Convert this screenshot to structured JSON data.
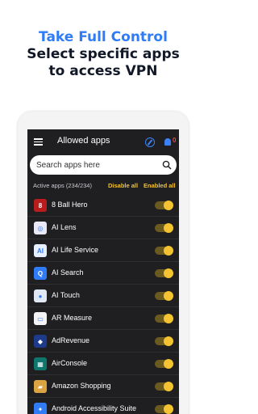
{
  "headline": {
    "line1": "Take Full Control",
    "line2": "Select specific apps",
    "line3": "to access VPN"
  },
  "appbar": {
    "title": "Allowed apps",
    "badge": "0"
  },
  "search": {
    "placeholder": "Search apps here"
  },
  "filters": {
    "active_count": "Active apps (234/234)",
    "disable_all": "Disable all",
    "enable_all": "Enabled all"
  },
  "apps": [
    {
      "name": "8 Ball Hero",
      "icon": "8",
      "color": "#b91c1c",
      "enabled": true
    },
    {
      "name": "AI Lens",
      "icon": "◎",
      "color": "#e8e8f7",
      "enabled": true
    },
    {
      "name": "AI Life Service",
      "icon": "AI",
      "color": "#e5efff",
      "enabled": true
    },
    {
      "name": "AI Search",
      "icon": "Q",
      "color": "#2f7cf6",
      "enabled": true
    },
    {
      "name": "AI Touch",
      "icon": "●",
      "color": "#dfe8f3",
      "enabled": true
    },
    {
      "name": "AR Measure",
      "icon": "▭",
      "color": "#f3f3f3",
      "enabled": true
    },
    {
      "name": "AdRevenue",
      "icon": "◆",
      "color": "#1e3a8a",
      "enabled": true
    },
    {
      "name": "AirConsole",
      "icon": "▦",
      "color": "#0f766e",
      "enabled": true
    },
    {
      "name": "Amazon Shopping",
      "icon": "▰",
      "color": "#d9a441",
      "enabled": true
    },
    {
      "name": "Android Accessibility Suite",
      "icon": "✦",
      "color": "#2f7cf6",
      "enabled": true
    }
  ]
}
